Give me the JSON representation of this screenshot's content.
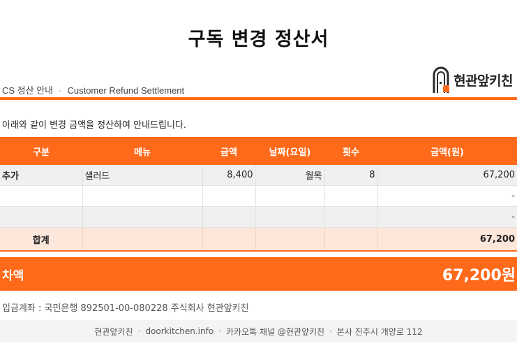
{
  "document": {
    "title": "구독 변경 정산서",
    "subtitle_left": "CS 정산 안내",
    "subtitle_right": "Customer Refund Settlement",
    "subtitle_separator": "·",
    "brand_name": "현관앞키친",
    "intro": "아래와 같이 변경 금액을 정산하여 안내드립니다."
  },
  "table": {
    "headers": [
      "구분",
      "메뉴",
      "금액",
      "날짜(요일)",
      "횟수",
      "금액(원)"
    ],
    "rows": [
      {
        "type": "추가",
        "menu": "샐러드",
        "price": "8,400",
        "day": "월목",
        "count": "8",
        "amount": "67,200"
      },
      {
        "type": "",
        "menu": "",
        "price": "",
        "day": "",
        "count": "",
        "amount": "-"
      },
      {
        "type": "",
        "menu": "",
        "price": "",
        "day": "",
        "count": "",
        "amount": "-"
      }
    ],
    "total_label": "합계",
    "total_amount": "67,200"
  },
  "difference": {
    "label": "차액",
    "value": "67,200원"
  },
  "bank_info": "입금계좌 : 국민은행 892501-00-080228 주식회사 현관앞키친",
  "footer": {
    "items": [
      "현관앞키친",
      "doorkitchen.info",
      "카카오톡 채널 @현관앞키친",
      "본사 진주시 개양로 112"
    ],
    "separator": "·"
  },
  "colors": {
    "accent": "#ff6a1a",
    "total_row_bg": "#fde6da",
    "striped_row_bg": "#f0f0f0",
    "footer_bg": "#f4f4f4"
  },
  "icons": {
    "logo": "door-kitchen-logo-icon"
  }
}
